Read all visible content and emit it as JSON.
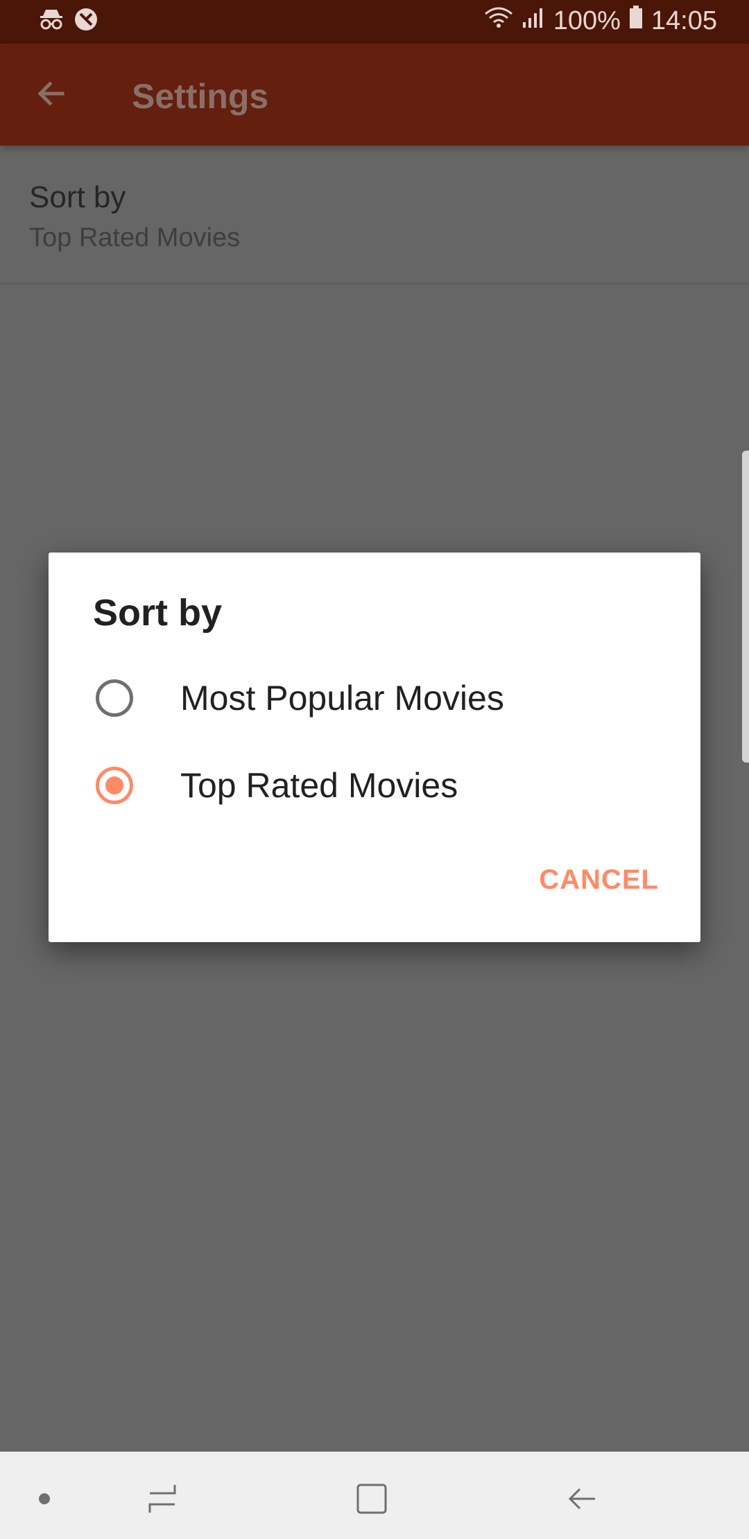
{
  "status_bar": {
    "battery": "100%",
    "time": "14:05",
    "icons": [
      "incognito-icon",
      "no-sync-icon",
      "wifi-icon",
      "signal-icon",
      "battery-icon"
    ]
  },
  "app_bar": {
    "title": "Settings",
    "back_icon": "arrow-back-icon"
  },
  "settings": {
    "items": [
      {
        "title": "Sort by",
        "summary": "Top Rated Movies"
      }
    ]
  },
  "dialog": {
    "title": "Sort by",
    "options": [
      {
        "label": "Most Popular Movies",
        "selected": false
      },
      {
        "label": "Top Rated Movies",
        "selected": true
      }
    ],
    "cancel_label": "CANCEL"
  },
  "colors": {
    "status_bar": "#4a1608",
    "app_bar": "#641f0f",
    "accent": "#ff8a65",
    "scrim_background": "#666666"
  },
  "nav_bar": {
    "icons": [
      "dot-icon",
      "recents-icon",
      "home-icon",
      "back-icon"
    ]
  }
}
